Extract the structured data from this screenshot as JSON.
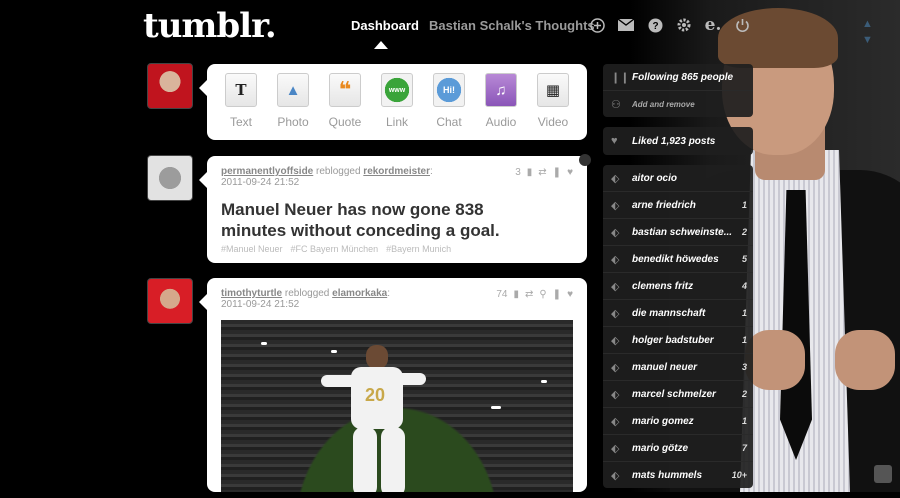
{
  "brand": {
    "logo": "tumblr."
  },
  "nav": {
    "dashboard": "Dashboard",
    "blog": "Bastian Schalk's Thoughts",
    "icons": [
      "plus-icon",
      "mail-icon",
      "help-icon",
      "gear-icon",
      "e-icon",
      "power-icon"
    ]
  },
  "composer": {
    "types": [
      {
        "label": "Text",
        "glyph": "T"
      },
      {
        "label": "Photo",
        "glyph": "▲"
      },
      {
        "label": "Quote",
        "glyph": "❝"
      },
      {
        "label": "Link",
        "glyph": "www"
      },
      {
        "label": "Chat",
        "glyph": "Hi!"
      },
      {
        "label": "Audio",
        "glyph": "♫"
      },
      {
        "label": "Video",
        "glyph": "▦"
      }
    ]
  },
  "posts": [
    {
      "user": "permanentlyoffside",
      "action": "reblogged",
      "source": "rekordmeister",
      "timestamp": "2011-09-24 21:52",
      "notes": "3",
      "title": "Manuel Neuer has now gone 838 minutes without conceding a goal.",
      "tags": [
        "#Manuel Neuer",
        "#FC Bayern München",
        "#Bayern Munich"
      ]
    },
    {
      "user": "timothyturtle",
      "action": "reblogged",
      "source": "elamorkaka",
      "timestamp": "2011-09-24 21:52",
      "notes": "74",
      "photo_jersey": "20"
    }
  ],
  "sidebar": {
    "following": "Following 865 people",
    "add_remove": "Add and remove",
    "liked": "Liked 1,923 posts",
    "tags": [
      {
        "label": "aitor ocio",
        "count": ""
      },
      {
        "label": "arne friedrich",
        "count": "1"
      },
      {
        "label": "bastian schweinste...",
        "count": "2"
      },
      {
        "label": "benedikt höwedes",
        "count": "5"
      },
      {
        "label": "clemens fritz",
        "count": "4"
      },
      {
        "label": "die mannschaft",
        "count": "1"
      },
      {
        "label": "holger badstuber",
        "count": "1"
      },
      {
        "label": "manuel neuer",
        "count": "3"
      },
      {
        "label": "marcel schmelzer",
        "count": "2"
      },
      {
        "label": "mario gomez",
        "count": "1"
      },
      {
        "label": "mario götze",
        "count": "7"
      },
      {
        "label": "mats hummels",
        "count": "10+"
      }
    ]
  }
}
